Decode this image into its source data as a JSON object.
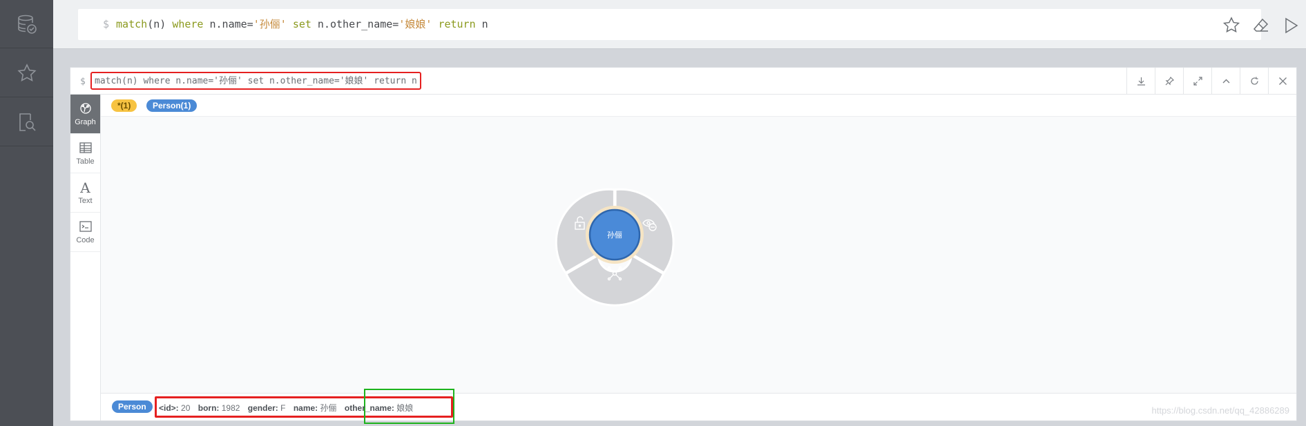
{
  "editor": {
    "prompt": "$",
    "tokens": [
      {
        "text": "match",
        "cls": "kw"
      },
      {
        "text": "(n) ",
        "cls": "plain"
      },
      {
        "text": "where",
        "cls": "kw"
      },
      {
        "text": " n.name=",
        "cls": "plain"
      },
      {
        "text": "'孙俪'",
        "cls": "str"
      },
      {
        "text": " ",
        "cls": "plain"
      },
      {
        "text": "set",
        "cls": "kw"
      },
      {
        "text": " n.other_name=",
        "cls": "plain"
      },
      {
        "text": "'娘娘'",
        "cls": "str"
      },
      {
        "text": " ",
        "cls": "plain"
      },
      {
        "text": "return",
        "cls": "kw"
      },
      {
        "text": " n",
        "cls": "plain"
      }
    ],
    "actions": [
      "star-icon",
      "eraser-icon",
      "play-icon"
    ]
  },
  "sidebar": {
    "items": [
      "database-icon",
      "star-icon",
      "search-document-icon"
    ]
  },
  "frame": {
    "prompt": "$",
    "query": "match(n) where n.name='孙俪' set n.other_name='娘娘' return n",
    "tools": [
      "download-icon",
      "pin-icon",
      "expand-icon",
      "collapse-icon",
      "refresh-icon",
      "close-icon"
    ],
    "tabs": [
      {
        "label": "Graph",
        "icon": "graph-icon",
        "active": true
      },
      {
        "label": "Table",
        "icon": "table-icon",
        "active": false
      },
      {
        "label": "Text",
        "icon": "text-icon",
        "active": false
      },
      {
        "label": "Code",
        "icon": "code-icon",
        "active": false
      }
    ],
    "legend": {
      "all_label": "*(1)",
      "person_label": "Person(1)"
    },
    "graph": {
      "node_label": "孙俪",
      "node_color": "#4a8ad8",
      "ring_color": "#f5e4c4",
      "menu": [
        "unlock-icon",
        "hide-eye-icon",
        "expand-relationships-icon"
      ]
    },
    "status": {
      "label": "Person",
      "props": [
        {
          "key": "<id>:",
          "value": "20"
        },
        {
          "key": "born:",
          "value": "1982"
        },
        {
          "key": "gender:",
          "value": "F"
        },
        {
          "key": "name:",
          "value": "孙俪"
        },
        {
          "key": "other_name:",
          "value": "娘娘"
        }
      ],
      "watermark": "https://blog.csdn.net/qq_42886289"
    }
  }
}
